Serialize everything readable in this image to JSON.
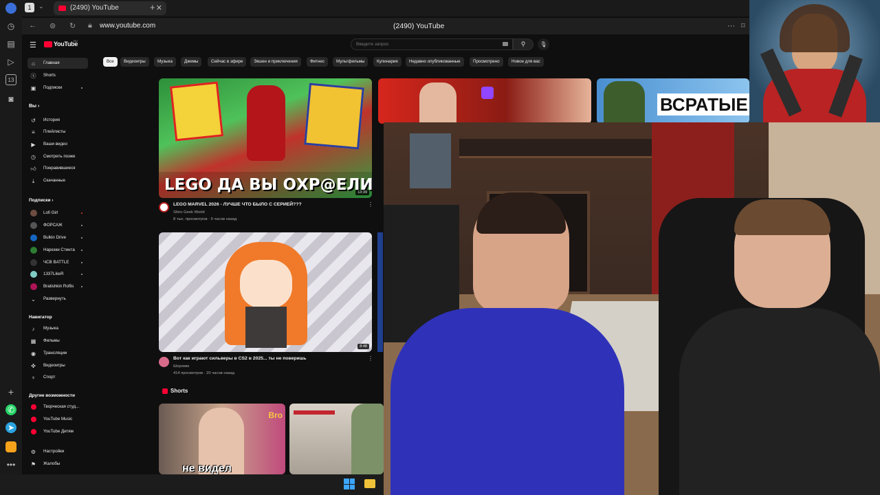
{
  "browser": {
    "tab_count": "1",
    "tab_title": "(2490) YouTube",
    "url": "www.youtube.com",
    "page_title": "(2490) YouTube",
    "accent": "#ff0033"
  },
  "youtube": {
    "logo_text": "YouTube",
    "logo_sup": "RU",
    "search_placeholder": "Введите запрос",
    "chips": [
      "Все",
      "Видеоигры",
      "Музыка",
      "Джемы",
      "Сейчас в эфире",
      "Экшен и приключения",
      "Фитнес",
      "Мультфильмы",
      "Кулинария",
      "Недавно опубликованные",
      "Просмотрено",
      "Новое для вас"
    ],
    "sidebar": {
      "main": [
        {
          "label": "Главная",
          "icon": "home-icon"
        },
        {
          "label": "Shorts",
          "icon": "shorts-icon"
        },
        {
          "label": "Подписки",
          "icon": "subscriptions-icon"
        }
      ],
      "you_header": "Вы",
      "you": [
        {
          "label": "История",
          "icon": "history-icon"
        },
        {
          "label": "Плейлисты",
          "icon": "playlist-icon"
        },
        {
          "label": "Ваши видео",
          "icon": "video-icon"
        },
        {
          "label": "Смотреть позже",
          "icon": "clock-icon"
        },
        {
          "label": "Понравившиеся",
          "icon": "like-icon"
        },
        {
          "label": "Скачанные",
          "icon": "download-icon"
        }
      ],
      "subs_header": "Подписки",
      "subs": [
        "Lofi Girl",
        "ФОРСАЖ",
        "Bulkin Drive",
        "Нарезки Стинта",
        "ЧСВ BATTLE",
        "1337LikeR",
        "Bratishkin Roflis",
        "Развернуть"
      ],
      "nav_header": "Навигатор",
      "nav": [
        {
          "label": "Музыка",
          "icon": "music-icon"
        },
        {
          "label": "Фильмы",
          "icon": "film-icon"
        },
        {
          "label": "Трансляции",
          "icon": "live-icon"
        },
        {
          "label": "Видеоигры",
          "icon": "gamepad-icon"
        },
        {
          "label": "Спорт",
          "icon": "trophy-icon"
        }
      ],
      "more_header": "Другие возможности",
      "more": [
        "Творческая студ...",
        "YouTube Music",
        "YouTube Детям"
      ],
      "bottom": [
        {
          "label": "Настройки",
          "icon": "gear-icon"
        },
        {
          "label": "Жалобы",
          "icon": "flag-icon"
        }
      ]
    },
    "videos": [
      {
        "title": "LEGO MARVEL 2026 - ЛУЧШЕ ЧТО БЫЛО С СЕРИЕЙ???",
        "channel": "Shiro Geek World",
        "meta": "8 тыс. просмотров · 5 часов назад",
        "duration": "13:39",
        "thumb_text": "LEGO ДА ВЫ ОХР@ЕЛИ???"
      },
      {
        "title": "Вот как играют сильверы в CS2 в 2025... ты не поверишь",
        "channel": "Шеромм",
        "meta": "414 просмотров · 20 часов назад",
        "duration": "8:48"
      }
    ],
    "partial_thumb_text": "ВСРАТЫЕ",
    "shorts_header": "Shorts",
    "short_caption": "не видел",
    "short_caption_2": "Bro"
  }
}
